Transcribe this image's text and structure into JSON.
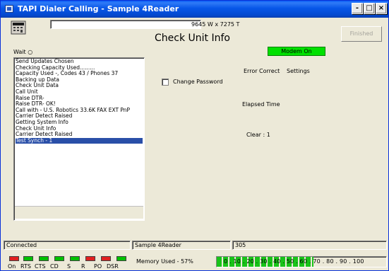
{
  "window": {
    "title": "TAPI Dialer  Calling - Sample 4Reader",
    "controls": {
      "minimize": "-",
      "maximize": "□",
      "close": "×"
    }
  },
  "toolbar": {
    "dimensions": "9645 W x 7275 T",
    "finished_label": "Finished"
  },
  "main": {
    "heading": "Check Unit Info",
    "wait_label": "Wait ○",
    "modem_status": "Modem On",
    "change_password_label": "Change Password",
    "error_correct_label": "Error Correct",
    "settings_label": "Settings",
    "elapsed_time_label": "Elapsed Time",
    "clear_label": "Clear : 1"
  },
  "log": {
    "items": [
      "Send Updates Chosen",
      "Checking Capacity Used.........",
      "Capacity Used -,  Codes 43 / Phones 37",
      "Backing up Data",
      "Check Unit Data",
      "Call Unit",
      " Raise DTR-",
      " Raise DTR- OK!",
      "Call with - U.S. Robotics 33.6K FAX EXT PnP",
      "Carrier Detect Raised",
      "Getting System Info",
      "Check Unit Info",
      "Carrier Detect Raised",
      "Test Synch - 1"
    ],
    "selected_index": 13
  },
  "status_bar": {
    "connection": "Connected",
    "reader": "Sample 4Reader",
    "number": "305"
  },
  "indicators": {
    "labels": [
      "On",
      "RTS",
      "CTS",
      "CD",
      "S",
      "R",
      "PO",
      "DSR"
    ],
    "colors": [
      "#e02020",
      "#00c000",
      "#00c000",
      "#00c000",
      "#00c000",
      "#e02020",
      "#e02020",
      "#00c000"
    ]
  },
  "memory": {
    "label": "Memory Used - 57%",
    "percent": 57,
    "ticks": "0 . 10 . 20 . 30 . 40 . 50 . 60 . 70 . 80 . 90 . 100"
  }
}
